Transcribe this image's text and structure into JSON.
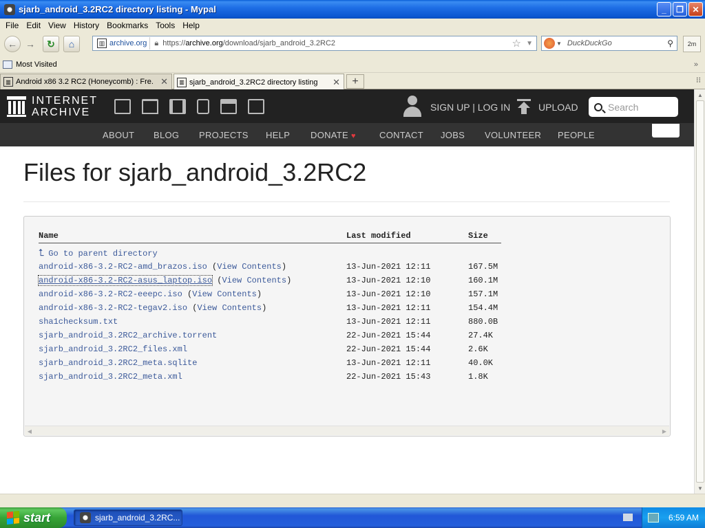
{
  "window": {
    "title": "sjarb_android_3.2RC2 directory listing - Mypal",
    "minimize": "_",
    "restore": "❐",
    "close": "✕"
  },
  "menu": [
    {
      "label": "File"
    },
    {
      "label": "Edit"
    },
    {
      "label": "View"
    },
    {
      "label": "History"
    },
    {
      "label": "Bookmarks"
    },
    {
      "label": "Tools"
    },
    {
      "label": "Help"
    }
  ],
  "navbar": {
    "site_identity": "archive.org",
    "url_prefix": "https://",
    "url_host": "archive.org",
    "url_path": "/download/sjarb_android_3.2RC2",
    "search_engine": "DuckDuckGo",
    "ext_button": "2m"
  },
  "bookmarks": {
    "most_visited": "Most Visited",
    "more": "»"
  },
  "tabs": [
    {
      "label": "Android x86 3.2 RC2 (Honeycomb) : Fre...",
      "active": false
    },
    {
      "label": "sjarb_android_3.2RC2 directory listing",
      "active": true
    }
  ],
  "tablist_glyph": "⁝⁝",
  "ia": {
    "logo_line1": "INTERNET",
    "logo_line2": "ARCHIVE",
    "signup": "SIGN UP | LOG IN",
    "upload": "UPLOAD",
    "search_placeholder": "Search",
    "nav": [
      "ABOUT",
      "BLOG",
      "PROJECTS",
      "HELP",
      "DONATE",
      "CONTACT",
      "JOBS",
      "VOLUNTEER",
      "PEOPLE"
    ],
    "donate_heart": "♥"
  },
  "page": {
    "title": "Files for sjarb_android_3.2RC2"
  },
  "listing": {
    "headers": {
      "name": "Name",
      "modified": "Last modified",
      "size": "Size"
    },
    "parent": "Go to parent directory",
    "view_contents": "View Contents",
    "rows": [
      {
        "name": "android-x86-3.2-RC2-amd_brazos.iso",
        "view": "(View Contents)",
        "modified": "13-Jun-2021 12:11",
        "size": "167.5M"
      },
      {
        "name": "android-x86-3.2-RC2-asus_laptop.iso",
        "view": "(View Contents)",
        "modified": "13-Jun-2021 12:10",
        "size": "160.1M"
      },
      {
        "name": "android-x86-3.2-RC2-eeepc.iso",
        "view": "(View Contents)",
        "modified": "13-Jun-2021 12:10",
        "size": "157.1M"
      },
      {
        "name": "android-x86-3.2-RC2-tegav2.iso",
        "view": "(View Contents)",
        "modified": "13-Jun-2021 12:11",
        "size": "154.4M"
      },
      {
        "name": "sha1checksum.txt",
        "view": "",
        "modified": "13-Jun-2021 12:11",
        "size": "880.0B"
      },
      {
        "name": "sjarb_android_3.2RC2_archive.torrent",
        "view": "",
        "modified": "22-Jun-2021 15:44",
        "size": "27.4K"
      },
      {
        "name": "sjarb_android_3.2RC2_files.xml",
        "view": "",
        "modified": "22-Jun-2021 15:44",
        "size": "2.6K"
      },
      {
        "name": "sjarb_android_3.2RC2_meta.sqlite",
        "view": "",
        "modified": "13-Jun-2021 12:11",
        "size": "40.0K"
      },
      {
        "name": "sjarb_android_3.2RC2_meta.xml",
        "view": "",
        "modified": "22-Jun-2021 15:43",
        "size": "1.8K"
      }
    ]
  },
  "taskbar": {
    "start": "start",
    "task_label": "sjarb_android_3.2RC...",
    "clock": "6:59 AM"
  },
  "colors": {
    "link": "#3c5a9a",
    "ia_header": "#222222",
    "ia_nav": "#333333",
    "donate_heart": "#e0393e"
  }
}
